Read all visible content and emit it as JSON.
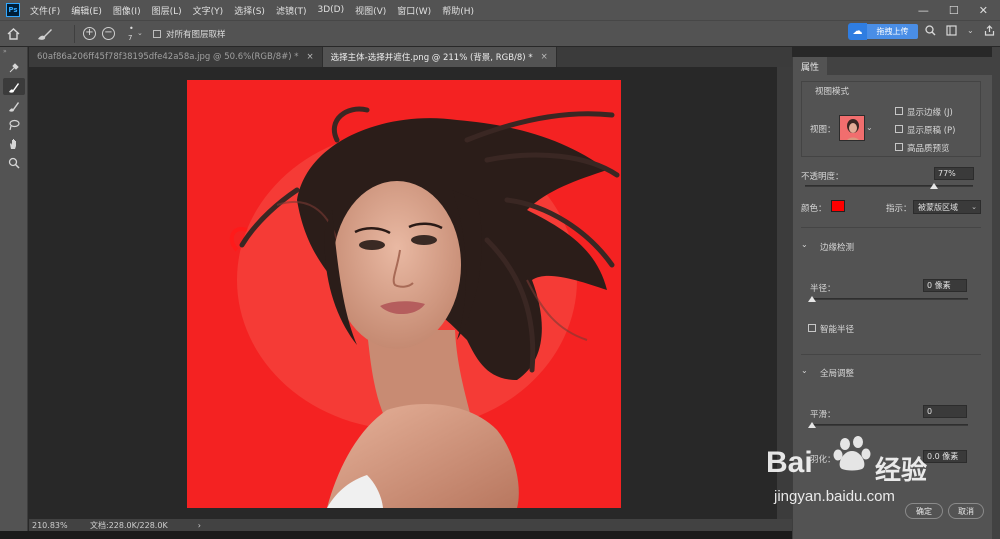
{
  "menubar": {
    "logo": "Ps",
    "items": [
      "文件(F)",
      "编辑(E)",
      "图像(I)",
      "图层(L)",
      "文字(Y)",
      "选择(S)",
      "滤镜(T)",
      "3D(D)",
      "视图(V)",
      "窗口(W)",
      "帮助(H)"
    ],
    "minimize": "—",
    "restore": "☐",
    "close": "✕"
  },
  "options": {
    "brush_size": "7",
    "sample_all_label": "对所有图层取样",
    "upload_label": "拖拽上传"
  },
  "tabs": [
    {
      "label": "60af86a206ff45f78f38195dfe42a58a.jpg @ 50.6%(RGB/8#) *",
      "close": "×"
    },
    {
      "label": "选择主体-选择并遮住.png @ 211% (背景, RGB/8) *",
      "close": "×"
    }
  ],
  "status": {
    "zoom": "210.83%",
    "doc": "文档:228.0K/228.0K",
    "arrow": "›"
  },
  "panel": {
    "tab": "属性",
    "view_mode": {
      "title": "视图模式",
      "view_label": "视图：",
      "show_edge": "显示边缘 (J)",
      "show_original": "显示原稿 (P)",
      "hq_preview": "高品质预览"
    },
    "opacity": {
      "label": "不透明度：",
      "value": "77%",
      "level": 0.77
    },
    "color_label": "颜色：",
    "color_value": "#ff0000",
    "indicate_label": "指示：",
    "indicate_value": "被蒙版区域",
    "edge_detection": {
      "title": "边缘检测",
      "radius_label": "半径：",
      "radius_value": "0 像素",
      "smart_radius": "智能半径"
    },
    "global_refine": {
      "title": "全局调整",
      "smooth_label": "平滑：",
      "smooth_value": "0",
      "feather_label": "羽化：",
      "feather_value": "0.0 像素"
    },
    "ok_label": "确定",
    "cancel_label": "取消"
  },
  "watermark": {
    "brand": "Bai",
    "brand2": "经验",
    "url": "jingyan.baidu.com"
  }
}
